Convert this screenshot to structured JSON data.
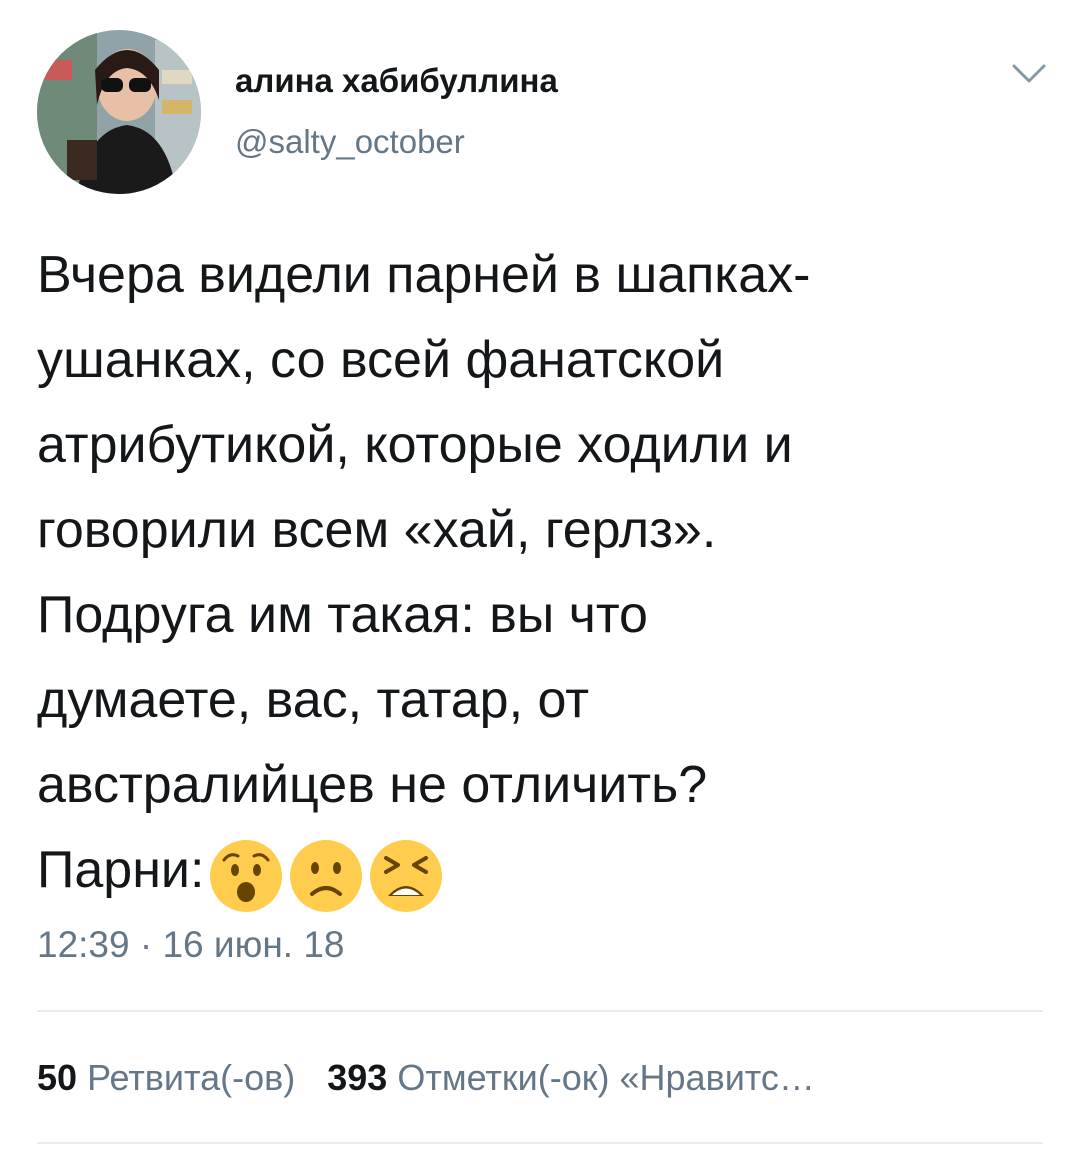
{
  "author": {
    "display_name": "алина хабибуллина",
    "handle": "@salty_october"
  },
  "tweet": {
    "text": "Вчера видели парней в шапках-\nушанках, со всей фанатской\nатрибутикой, которые ходили и\nговорили всем «хай, герлз».\nПодруга им такая: вы что\nдумаете, вас, татар, от\nавстралийцев не отличить?\nПарни:",
    "emojis": [
      "anguished-face",
      "slightly-frowning-face",
      "tired-face"
    ],
    "timestamp": "12:39 · 16 июн. 18"
  },
  "stats": {
    "retweets_count": "50",
    "retweets_label": "Ретвита(-ов)",
    "likes_count": "393",
    "likes_label": "Отметки(-ок) «Нравитс…"
  },
  "icons": {
    "menu": "chevron-down-icon"
  },
  "colors": {
    "text_primary": "#14171a",
    "text_secondary": "#657786",
    "divider": "#e6ecf0",
    "emoji_yellow": "#ffcc4d"
  }
}
